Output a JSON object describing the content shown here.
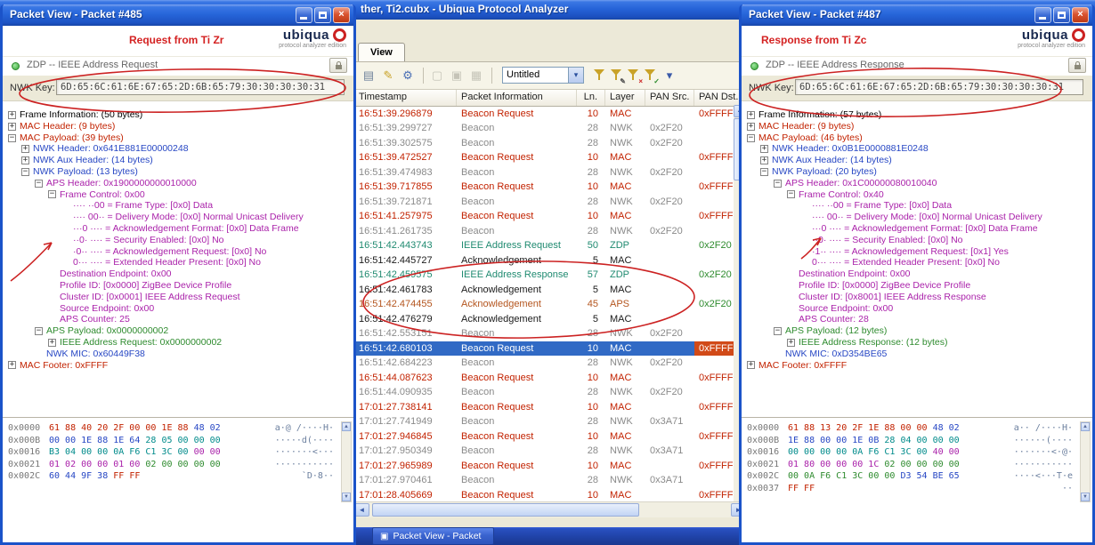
{
  "colors": {
    "mac": "#c22200",
    "nwk": "#8a8a8a",
    "nwkhdr": "#2747c4",
    "aux": "#008b8b",
    "aps": "#aa22aa",
    "payload": "#2e8b2e",
    "mic": "#2747c4",
    "zdp": "#1f8a70",
    "apsrow": "#b4551e",
    "ack": "#1a1a1a",
    "black": "#000000",
    "green": "#2e8b2e",
    "selection": "#316ac5",
    "annotation": "#cc2222"
  },
  "icons": {
    "close": "×",
    "up": "▲",
    "down": "▼",
    "left": "◄",
    "right": "►",
    "combo_arrow": "▾",
    "taskbar_icon": "▣"
  },
  "app_window": {
    "title": "ther, Ti2.cubx - Ubiqua Protocol Analyzer",
    "tab_label": "View",
    "toolbar": {
      "profile_value": "Untitled",
      "icons_left": [
        {
          "name": "save-icon",
          "glyph": "▤",
          "color": "#70839c"
        },
        {
          "name": "highlighter-icon",
          "glyph": "✎",
          "color": "#c9a227"
        },
        {
          "name": "gear-icon",
          "glyph": "⚙",
          "color": "#4a6fb5"
        },
        {
          "sep": 1
        },
        {
          "name": "window-icon",
          "glyph": "▢",
          "color": "#8a8a7e",
          "dim": 1
        },
        {
          "name": "panels-icon",
          "glyph": "▣",
          "color": "#8a8a7e",
          "dim": 1
        },
        {
          "name": "chart-icon",
          "glyph": "▦",
          "color": "#8a8a7e",
          "dim": 1
        },
        {
          "sep": 1
        }
      ],
      "icons_right": [
        {
          "name": "filter-icon",
          "funnel": 1,
          "mark": "",
          "markcolor": "#555555"
        },
        {
          "name": "filter-edit-icon",
          "funnel": 1,
          "mark": "✎",
          "markcolor": "#555555"
        },
        {
          "name": "filter-delete-icon",
          "funnel": 1,
          "mark": "×",
          "markcolor": "#cc2222"
        },
        {
          "name": "filter-apply-icon",
          "funnel": 1,
          "mark": "✓",
          "markcolor": "#2a8a2a"
        },
        {
          "name": "chevron-down-icon",
          "glyph": "▾",
          "color": "#3a5aa8"
        }
      ]
    },
    "table": {
      "columns": [
        "Timestamp",
        "Packet Information",
        "Ln.",
        "Layer",
        "PAN Src.",
        "PAN Dst."
      ],
      "rows": [
        {
          "ts": "16:51:39.296879",
          "info": "Beacon Request",
          "ln": "10",
          "layer": "MAC",
          "src": "",
          "dst": "0xFFFF",
          "c": "mac"
        },
        {
          "ts": "16:51:39.299727",
          "info": "Beacon",
          "ln": "28",
          "layer": "NWK",
          "src": "0x2F20",
          "dst": "",
          "c": "nwk"
        },
        {
          "ts": "16:51:39.302575",
          "info": "Beacon",
          "ln": "28",
          "layer": "NWK",
          "src": "0x2F20",
          "dst": "",
          "c": "nwk"
        },
        {
          "ts": "16:51:39.472527",
          "info": "Beacon Request",
          "ln": "10",
          "layer": "MAC",
          "src": "",
          "dst": "0xFFFF",
          "c": "mac"
        },
        {
          "ts": "16:51:39.474983",
          "info": "Beacon",
          "ln": "28",
          "layer": "NWK",
          "src": "0x2F20",
          "dst": "",
          "c": "nwk"
        },
        {
          "ts": "16:51:39.717855",
          "info": "Beacon Request",
          "ln": "10",
          "layer": "MAC",
          "src": "",
          "dst": "0xFFFF",
          "c": "mac"
        },
        {
          "ts": "16:51:39.721871",
          "info": "Beacon",
          "ln": "28",
          "layer": "NWK",
          "src": "0x2F20",
          "dst": "",
          "c": "nwk"
        },
        {
          "ts": "16:51:41.257975",
          "info": "Beacon Request",
          "ln": "10",
          "layer": "MAC",
          "src": "",
          "dst": "0xFFFF",
          "c": "mac"
        },
        {
          "ts": "16:51:41.261735",
          "info": "Beacon",
          "ln": "28",
          "layer": "NWK",
          "src": "0x2F20",
          "dst": "",
          "c": "nwk"
        },
        {
          "ts": "16:51:42.443743",
          "info": "IEEE Address Request",
          "ln": "50",
          "layer": "ZDP",
          "src": "",
          "dst": "0x2F20",
          "c": "zdp",
          "dstc": "green"
        },
        {
          "ts": "16:51:42.445727",
          "info": "Acknowledgement",
          "ln": "5",
          "layer": "MAC",
          "src": "",
          "dst": "",
          "c": "ack"
        },
        {
          "ts": "16:51:42.459575",
          "info": "IEEE Address Response",
          "ln": "57",
          "layer": "ZDP",
          "src": "",
          "dst": "0x2F20",
          "c": "zdp",
          "dstc": "green"
        },
        {
          "ts": "16:51:42.461783",
          "info": "Acknowledgement",
          "ln": "5",
          "layer": "MAC",
          "src": "",
          "dst": "",
          "c": "ack"
        },
        {
          "ts": "16:51:42.474455",
          "info": "Acknowledgement",
          "ln": "45",
          "layer": "APS",
          "src": "",
          "dst": "0x2F20",
          "c": "apsrow",
          "dstc": "green"
        },
        {
          "ts": "16:51:42.476279",
          "info": "Acknowledgement",
          "ln": "5",
          "layer": "MAC",
          "src": "",
          "dst": "",
          "c": "ack"
        },
        {
          "ts": "16:51:42.553151",
          "info": "Beacon",
          "ln": "28",
          "layer": "NWK",
          "src": "0x2F20",
          "dst": "",
          "c": "nwk"
        },
        {
          "ts": "16:51:42.680103",
          "info": "Beacon Request",
          "ln": "10",
          "layer": "MAC",
          "src": "",
          "dst": "0xFFFF",
          "c": "mac",
          "sel": 1
        },
        {
          "ts": "16:51:42.684223",
          "info": "Beacon",
          "ln": "28",
          "layer": "NWK",
          "src": "0x2F20",
          "dst": "",
          "c": "nwk"
        },
        {
          "ts": "16:51:44.087623",
          "info": "Beacon Request",
          "ln": "10",
          "layer": "MAC",
          "src": "",
          "dst": "0xFFFF",
          "c": "mac"
        },
        {
          "ts": "16:51:44.090935",
          "info": "Beacon",
          "ln": "28",
          "layer": "NWK",
          "src": "0x2F20",
          "dst": "",
          "c": "nwk"
        },
        {
          "ts": "17:01:27.738141",
          "info": "Beacon Request",
          "ln": "10",
          "layer": "MAC",
          "src": "",
          "dst": "0xFFFF",
          "c": "mac"
        },
        {
          "ts": "17:01:27.741949",
          "info": "Beacon",
          "ln": "28",
          "layer": "NWK",
          "src": "0x3A71",
          "dst": "",
          "c": "nwk"
        },
        {
          "ts": "17:01:27.946845",
          "info": "Beacon Request",
          "ln": "10",
          "layer": "MAC",
          "src": "",
          "dst": "0xFFFF",
          "c": "mac"
        },
        {
          "ts": "17:01:27.950349",
          "info": "Beacon",
          "ln": "28",
          "layer": "NWK",
          "src": "0x3A71",
          "dst": "",
          "c": "nwk"
        },
        {
          "ts": "17:01:27.965989",
          "info": "Beacon Request",
          "ln": "10",
          "layer": "MAC",
          "src": "",
          "dst": "0xFFFF",
          "c": "mac"
        },
        {
          "ts": "17:01:27.970461",
          "info": "Beacon",
          "ln": "28",
          "layer": "NWK",
          "src": "0x3A71",
          "dst": "",
          "c": "nwk"
        },
        {
          "ts": "17:01:28.405669",
          "info": "Beacon Request",
          "ln": "10",
          "layer": "MAC",
          "src": "",
          "dst": "0xFFFF",
          "c": "mac"
        }
      ]
    }
  },
  "taskbar": {
    "button_label": "Packet View - Packet"
  },
  "left_window": {
    "title": "Packet View - Packet #485",
    "annotation_text": "Request from Ti Zr",
    "brand": "ubiqua",
    "brand_tagline": "protocol analyzer edition",
    "packet_type": "ZDP -- IEEE Address Request",
    "nwk_key_label": "NWK Key:",
    "nwk_key_value": "6D:65:6C:61:6E:67:65:2D:6B:65:79:30:30:30:30:31",
    "tree": [
      {
        "d": 0,
        "e": "+",
        "t": "Frame Information: (50 bytes)",
        "c": "black"
      },
      {
        "d": 0,
        "e": "+",
        "t": "MAC Header: (9 bytes)",
        "c": "mac"
      },
      {
        "d": 0,
        "e": "-",
        "t": "MAC Payload: (39 bytes)",
        "c": "mac"
      },
      {
        "d": 1,
        "e": "+",
        "t": "NWK Header: 0x641E881E00000248",
        "c": "nwkhdr"
      },
      {
        "d": 1,
        "e": "+",
        "t": "NWK Aux Header: (14 bytes)",
        "c": "nwkhdr"
      },
      {
        "d": 1,
        "e": "-",
        "t": "NWK Payload: (13 bytes)",
        "c": "nwkhdr"
      },
      {
        "d": 2,
        "e": "-",
        "t": "APS Header: 0x1900000000010000",
        "c": "aps"
      },
      {
        "d": 3,
        "e": "-",
        "t": "Frame Control: 0x00",
        "c": "aps"
      },
      {
        "d": 4,
        "e": "",
        "t": "···· ··00 = Frame Type: [0x0] Data",
        "c": "aps"
      },
      {
        "d": 4,
        "e": "",
        "t": "···· 00·· = Delivery Mode: [0x0] Normal Unicast Delivery",
        "c": "aps"
      },
      {
        "d": 4,
        "e": "",
        "t": "···0 ···· = Acknowledgement Format: [0x0] Data Frame",
        "c": "aps"
      },
      {
        "d": 4,
        "e": "",
        "t": "··0· ···· = Security Enabled: [0x0] No",
        "c": "aps"
      },
      {
        "d": 4,
        "e": "",
        "t": "·0·· ···· = Acknowledgement Request: [0x0] No",
        "c": "aps"
      },
      {
        "d": 4,
        "e": "",
        "t": "0··· ···· = Extended Header Present: [0x0] No",
        "c": "aps"
      },
      {
        "d": 3,
        "e": "",
        "t": "Destination Endpoint: 0x00",
        "c": "aps"
      },
      {
        "d": 3,
        "e": "",
        "t": "Profile ID: [0x0000] ZigBee Device Profile",
        "c": "aps"
      },
      {
        "d": 3,
        "e": "",
        "t": "Cluster ID: [0x0001] IEEE Address Request",
        "c": "aps"
      },
      {
        "d": 3,
        "e": "",
        "t": "Source Endpoint: 0x00",
        "c": "aps"
      },
      {
        "d": 3,
        "e": "",
        "t": "APS Counter: 25",
        "c": "aps"
      },
      {
        "d": 2,
        "e": "-",
        "t": "APS Payload: 0x0000000002",
        "c": "payload"
      },
      {
        "d": 3,
        "e": "+",
        "t": "IEEE Address Request: 0x0000000002",
        "c": "payload"
      },
      {
        "d": 2,
        "e": "",
        "t": "NWK MIC: 0x60449F38",
        "c": "mic"
      },
      {
        "d": 0,
        "e": "+",
        "t": "MAC Footer: 0xFFFF",
        "c": "mac"
      }
    ],
    "hex_rows": [
      {
        "off": "0x0000",
        "segs": [
          {
            "t": "61 88 40 20 2F 00 00 1E 88",
            "c": "mac"
          },
          {
            "t": "48 02",
            "c": "nwkhdr"
          }
        ],
        "ascii": "a·@ /····H·"
      },
      {
        "off": "0x000B",
        "segs": [
          {
            "t": "00 00 1E 88 1E 64",
            "c": "nwkhdr"
          },
          {
            "t": "28 05 00 00 00",
            "c": "aux"
          }
        ],
        "ascii": "·····d(····"
      },
      {
        "off": "0x0016",
        "segs": [
          {
            "t": "B3 04 00 00 0A F6 C1 3C 00",
            "c": "aux"
          },
          {
            "t": "00 00",
            "c": "aps"
          }
        ],
        "ascii": "·······<···"
      },
      {
        "off": "0x0021",
        "segs": [
          {
            "t": "01 02 00 00 01 00",
            "c": "aps"
          },
          {
            "t": "02 00 00 00 00",
            "c": "payload"
          }
        ],
        "ascii": "···········"
      },
      {
        "off": "0x002C",
        "segs": [
          {
            "t": "60 44 9F 38",
            "c": "mic"
          },
          {
            "t": "FF FF",
            "c": "mac"
          }
        ],
        "ascii": "`D·8··"
      }
    ]
  },
  "right_window": {
    "title": "Packet View - Packet #487",
    "annotation_text": "Response from Ti Zc",
    "brand": "ubiqua",
    "brand_tagline": "protocol analyzer edition",
    "packet_type": "ZDP -- IEEE Address Response",
    "nwk_key_label": "NWK Key:",
    "nwk_key_value": "6D:65:6C:61:6E:67:65:2D:6B:65:79:30:30:30:30:31",
    "tree": [
      {
        "d": 0,
        "e": "+",
        "t": "Frame Information: (57 bytes)",
        "c": "black"
      },
      {
        "d": 0,
        "e": "+",
        "t": "MAC Header: (9 bytes)",
        "c": "mac"
      },
      {
        "d": 0,
        "e": "-",
        "t": "MAC Payload: (46 bytes)",
        "c": "mac"
      },
      {
        "d": 1,
        "e": "+",
        "t": "NWK Header: 0x0B1E0000881E0248",
        "c": "nwkhdr"
      },
      {
        "d": 1,
        "e": "+",
        "t": "NWK Aux Header: (14 bytes)",
        "c": "nwkhdr"
      },
      {
        "d": 1,
        "e": "-",
        "t": "NWK Payload: (20 bytes)",
        "c": "nwkhdr"
      },
      {
        "d": 2,
        "e": "-",
        "t": "APS Header: 0x1C00000080010040",
        "c": "aps"
      },
      {
        "d": 3,
        "e": "-",
        "t": "Frame Control: 0x40",
        "c": "aps"
      },
      {
        "d": 4,
        "e": "",
        "t": "···· ··00 = Frame Type: [0x0] Data",
        "c": "aps"
      },
      {
        "d": 4,
        "e": "",
        "t": "···· 00·· = Delivery Mode: [0x0] Normal Unicast Delivery",
        "c": "aps"
      },
      {
        "d": 4,
        "e": "",
        "t": "···0 ···· = Acknowledgement Format: [0x0] Data Frame",
        "c": "aps"
      },
      {
        "d": 4,
        "e": "",
        "t": "··0· ···· = Security Enabled: [0x0] No",
        "c": "aps"
      },
      {
        "d": 4,
        "e": "",
        "t": "·1·· ···· = Acknowledgement Request: [0x1] Yes",
        "c": "aps"
      },
      {
        "d": 4,
        "e": "",
        "t": "0··· ···· = Extended Header Present: [0x0] No",
        "c": "aps"
      },
      {
        "d": 3,
        "e": "",
        "t": "Destination Endpoint: 0x00",
        "c": "aps"
      },
      {
        "d": 3,
        "e": "",
        "t": "Profile ID: [0x0000] ZigBee Device Profile",
        "c": "aps"
      },
      {
        "d": 3,
        "e": "",
        "t": "Cluster ID: [0x8001] IEEE Address Response",
        "c": "aps"
      },
      {
        "d": 3,
        "e": "",
        "t": "Source Endpoint: 0x00",
        "c": "aps"
      },
      {
        "d": 3,
        "e": "",
        "t": "APS Counter: 28",
        "c": "aps"
      },
      {
        "d": 2,
        "e": "-",
        "t": "APS Payload: (12 bytes)",
        "c": "payload"
      },
      {
        "d": 3,
        "e": "+",
        "t": "IEEE Address Response: (12 bytes)",
        "c": "payload"
      },
      {
        "d": 2,
        "e": "",
        "t": "NWK MIC: 0xD354BE65",
        "c": "mic"
      },
      {
        "d": 0,
        "e": "+",
        "t": "MAC Footer: 0xFFFF",
        "c": "mac"
      }
    ],
    "hex_rows": [
      {
        "off": "0x0000",
        "segs": [
          {
            "t": "61 88 13 20 2F 1E 88 00 00",
            "c": "mac"
          },
          {
            "t": "48 02",
            "c": "nwkhdr"
          }
        ],
        "ascii": "a·· /····H·"
      },
      {
        "off": "0x000B",
        "segs": [
          {
            "t": "1E 88 00 00 1E 0B",
            "c": "nwkhdr"
          },
          {
            "t": "28 04 00 00 00",
            "c": "aux"
          }
        ],
        "ascii": "······(····"
      },
      {
        "off": "0x0016",
        "segs": [
          {
            "t": "00 00 00 00 0A F6 C1 3C 00",
            "c": "aux"
          },
          {
            "t": "40 00",
            "c": "aps"
          }
        ],
        "ascii": "·······<·@·"
      },
      {
        "off": "0x0021",
        "segs": [
          {
            "t": "01 80 00 00 00 1C",
            "c": "aps"
          },
          {
            "t": "02 00 00 00 00",
            "c": "payload"
          }
        ],
        "ascii": "···········"
      },
      {
        "off": "0x002C",
        "segs": [
          {
            "t": "00 0A F6 C1 3C 00 00",
            "c": "payload"
          },
          {
            "t": "D3 54 BE 65",
            "c": "mic"
          }
        ],
        "ascii": "····<···T·e"
      },
      {
        "off": "0x0037",
        "segs": [
          {
            "t": "FF FF",
            "c": "mac"
          }
        ],
        "ascii": "··"
      }
    ]
  }
}
